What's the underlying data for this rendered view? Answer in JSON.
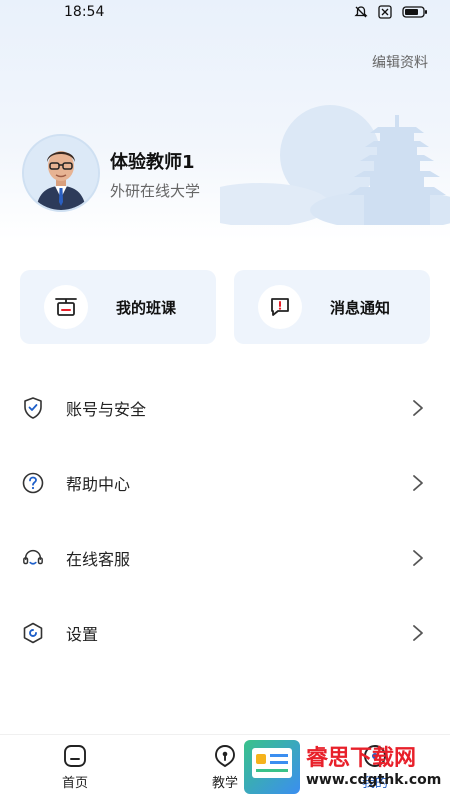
{
  "status_bar": {
    "time": "18:54"
  },
  "header": {
    "edit_label": "编辑资料"
  },
  "profile": {
    "name": "体验教师1",
    "school": "外研在线大学"
  },
  "quick_cards": [
    {
      "label": "我的班课",
      "icon": "classroom-icon"
    },
    {
      "label": "消息通知",
      "icon": "message-alert-icon"
    }
  ],
  "menu": [
    {
      "label": "账号与安全",
      "icon": "shield-check-icon"
    },
    {
      "label": "帮助中心",
      "icon": "question-circle-icon"
    },
    {
      "label": "在线客服",
      "icon": "headset-icon"
    },
    {
      "label": "设置",
      "icon": "settings-hex-icon"
    }
  ],
  "tabbar": [
    {
      "label": "首页",
      "icon": "home-icon"
    },
    {
      "label": "教学",
      "icon": "teaching-icon"
    },
    {
      "label": "我的",
      "icon": "profile-icon",
      "active": true
    }
  ],
  "watermark": {
    "title": "睿思下载网",
    "url": "www.cdgthk.com"
  },
  "colors": {
    "accent": "#1e5fc9",
    "card_bg": "#eef4fc",
    "watermark_red": "#e8202a"
  }
}
